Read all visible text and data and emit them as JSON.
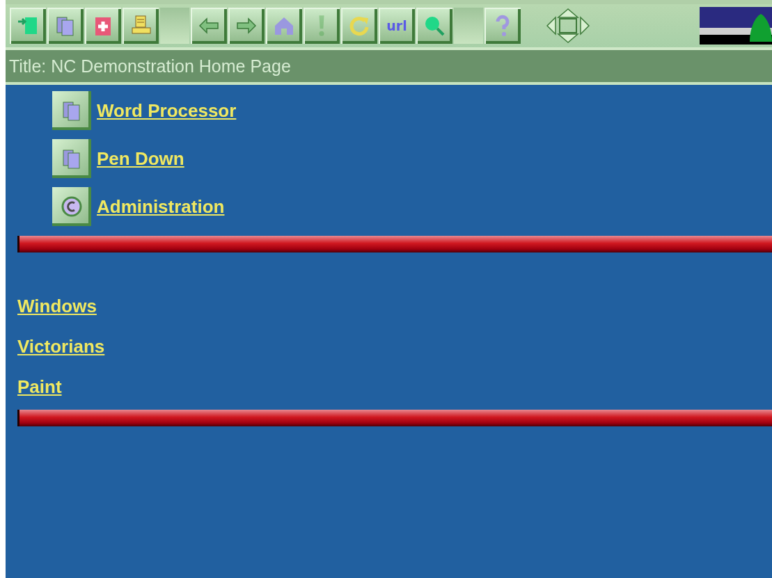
{
  "toolbar": {
    "buttons": [
      {
        "kind": "open",
        "disabled": false
      },
      {
        "kind": "pages",
        "disabled": false
      },
      {
        "kind": "new",
        "disabled": false
      },
      {
        "kind": "print",
        "disabled": false
      },
      {
        "kind": "spacer"
      },
      {
        "kind": "back",
        "disabled": false
      },
      {
        "kind": "forward",
        "disabled": false
      },
      {
        "kind": "home",
        "disabled": false
      },
      {
        "kind": "stop",
        "disabled": true
      },
      {
        "kind": "reload",
        "disabled": false
      },
      {
        "kind": "url",
        "label": "url",
        "disabled": false
      },
      {
        "kind": "search",
        "disabled": false
      },
      {
        "kind": "spacer"
      },
      {
        "kind": "help",
        "disabled": false
      }
    ]
  },
  "title_bar": {
    "text": "Title: NC Demonstration Home Page"
  },
  "app_links": [
    {
      "label": "Word Processor",
      "kind": "pages"
    },
    {
      "label": "Pen Down",
      "kind": "pages"
    },
    {
      "label": "Administration",
      "kind": "copyright"
    }
  ],
  "links": [
    {
      "label": "Windows"
    },
    {
      "label": "Victorians"
    },
    {
      "label": "Paint"
    }
  ]
}
